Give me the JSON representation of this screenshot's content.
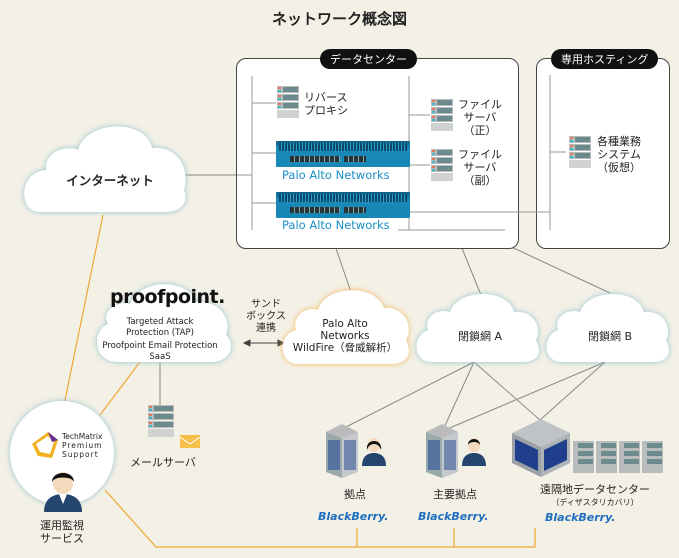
{
  "title": "ネットワーク概念図",
  "datacenter": {
    "label": "データセンター",
    "reverse_proxy": [
      "リバース",
      "プロキシ"
    ],
    "file_server_primary": [
      "ファイル",
      "サーバ",
      "（正）"
    ],
    "file_server_secondary": [
      "ファイル",
      "サーバ",
      "（副）"
    ],
    "firewall_1": "Palo Alto Networks",
    "firewall_2": "Palo Alto Networks"
  },
  "hosting": {
    "label": "専用ホスティング",
    "system": [
      "各種業務",
      "システム",
      "（仮想）"
    ]
  },
  "internet": "インターネット",
  "proofpoint": {
    "logo": "proofpoint.",
    "line1": "Targeted Attack",
    "line2": "Protection (TAP)",
    "line3": "Proofpoint Email Protection",
    "line4": "SaaS"
  },
  "sandbox": [
    "サンド",
    "ボックス",
    "連携"
  ],
  "wildfire": [
    "Palo Alto",
    "Networks",
    "WildFire（脅威解析）"
  ],
  "closed_a": "閉鎖網 A",
  "closed_b": "閉鎖網 B",
  "mail_server": "メールサーバ",
  "techmatrix": [
    "TechMatrix",
    "Premium",
    "Support"
  ],
  "ops": [
    "運用監視",
    "サービス"
  ],
  "sites": {
    "branch": "拠点",
    "main_branch": "主要拠点",
    "remote_dc": "遠隔地データセンター",
    "remote_dc_sub": "（ディザスタリカバリ）",
    "blackberry": "BlackBerry."
  },
  "colors": {
    "accent_orange": "#f0a830",
    "palo_blue": "#1a8fc7",
    "bb_blue": "#1f6fc0",
    "background": "#f3f0e6"
  }
}
